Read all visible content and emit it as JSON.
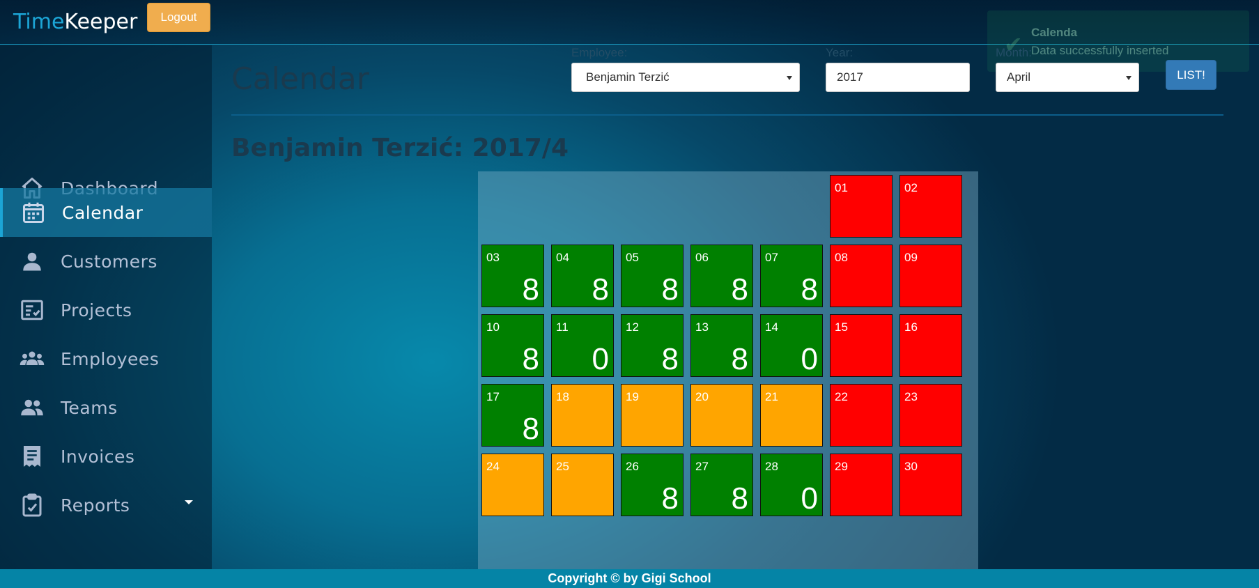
{
  "brand": {
    "part1": "Time",
    "part2": "Keeper"
  },
  "header": {
    "logout_label": "Logout"
  },
  "toast": {
    "title": "Calenda",
    "message": "Data successfully inserted"
  },
  "sidebar": {
    "items": [
      {
        "label": "Dashboard",
        "icon": "home-icon",
        "active": false
      },
      {
        "label": "Calendar",
        "icon": "calendar-icon",
        "active": true
      },
      {
        "label": "Customers",
        "icon": "person-icon",
        "active": false
      },
      {
        "label": "Projects",
        "icon": "checklist-icon",
        "active": false
      },
      {
        "label": "Employees",
        "icon": "group-icon",
        "active": false
      },
      {
        "label": "Teams",
        "icon": "people-icon",
        "active": false
      },
      {
        "label": "Invoices",
        "icon": "receipt-icon",
        "active": false
      },
      {
        "label": "Reports",
        "icon": "clipboard-icon",
        "active": false,
        "dropdown": true
      }
    ]
  },
  "main": {
    "title": "Calendar",
    "filters": {
      "employee_label": "Employee:",
      "employee_value": "Benjamin Terzić",
      "year_label": "Year:",
      "year_value": "2017",
      "month_label": "Month:",
      "month_value": "April",
      "list_button": "LIST!"
    },
    "calendar_title": "Benjamin Terzić: 2017/4"
  },
  "colors": {
    "worked": "#008000",
    "pending": "#ffa500",
    "weekend": "#ff0000"
  },
  "calendar": {
    "days": [
      {
        "day": "01",
        "status": "weekend",
        "hours": ""
      },
      {
        "day": "02",
        "status": "weekend",
        "hours": ""
      },
      {
        "day": "03",
        "status": "worked",
        "hours": "8"
      },
      {
        "day": "04",
        "status": "worked",
        "hours": "8"
      },
      {
        "day": "05",
        "status": "worked",
        "hours": "8"
      },
      {
        "day": "06",
        "status": "worked",
        "hours": "8"
      },
      {
        "day": "07",
        "status": "worked",
        "hours": "8"
      },
      {
        "day": "08",
        "status": "weekend",
        "hours": ""
      },
      {
        "day": "09",
        "status": "weekend",
        "hours": ""
      },
      {
        "day": "10",
        "status": "worked",
        "hours": "8"
      },
      {
        "day": "11",
        "status": "worked",
        "hours": "0"
      },
      {
        "day": "12",
        "status": "worked",
        "hours": "8"
      },
      {
        "day": "13",
        "status": "worked",
        "hours": "8"
      },
      {
        "day": "14",
        "status": "worked",
        "hours": "0"
      },
      {
        "day": "15",
        "status": "weekend",
        "hours": ""
      },
      {
        "day": "16",
        "status": "weekend",
        "hours": ""
      },
      {
        "day": "17",
        "status": "worked",
        "hours": "8"
      },
      {
        "day": "18",
        "status": "pending",
        "hours": ""
      },
      {
        "day": "19",
        "status": "pending",
        "hours": ""
      },
      {
        "day": "20",
        "status": "pending",
        "hours": ""
      },
      {
        "day": "21",
        "status": "pending",
        "hours": ""
      },
      {
        "day": "22",
        "status": "weekend",
        "hours": ""
      },
      {
        "day": "23",
        "status": "weekend",
        "hours": ""
      },
      {
        "day": "24",
        "status": "pending",
        "hours": ""
      },
      {
        "day": "25",
        "status": "pending",
        "hours": ""
      },
      {
        "day": "26",
        "status": "worked",
        "hours": "8"
      },
      {
        "day": "27",
        "status": "worked",
        "hours": "8"
      },
      {
        "day": "28",
        "status": "worked",
        "hours": "0"
      },
      {
        "day": "29",
        "status": "weekend",
        "hours": ""
      },
      {
        "day": "30",
        "status": "weekend",
        "hours": ""
      }
    ]
  },
  "footer": {
    "text": "Copyright © by Gigi School"
  }
}
